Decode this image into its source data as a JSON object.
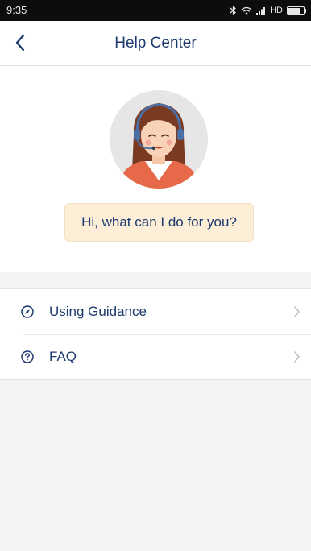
{
  "status_bar": {
    "time": "9:35",
    "network": "HD",
    "icons": [
      "bluetooth-icon",
      "wifi-icon",
      "signal-icon",
      "battery-icon"
    ],
    "battery_level": 0.8
  },
  "header": {
    "title": "Help Center",
    "back_icon": "chevron-left-icon"
  },
  "hero": {
    "avatar": "support-agent-avatar",
    "greeting": "Hi, what can I do for you?"
  },
  "menu": {
    "items": [
      {
        "label": "Using Guidance",
        "icon": "compass-icon",
        "trailing_icon": "chevron-right-icon"
      },
      {
        "label": "FAQ",
        "icon": "question-circle-icon",
        "trailing_icon": "chevron-right-icon"
      }
    ]
  },
  "colors": {
    "primary_text": "#1d3a6e",
    "bubble_bg": "#fdeed8",
    "page_bg": "#f4f4f4",
    "status_bar_bg": "#0d0d0d"
  }
}
